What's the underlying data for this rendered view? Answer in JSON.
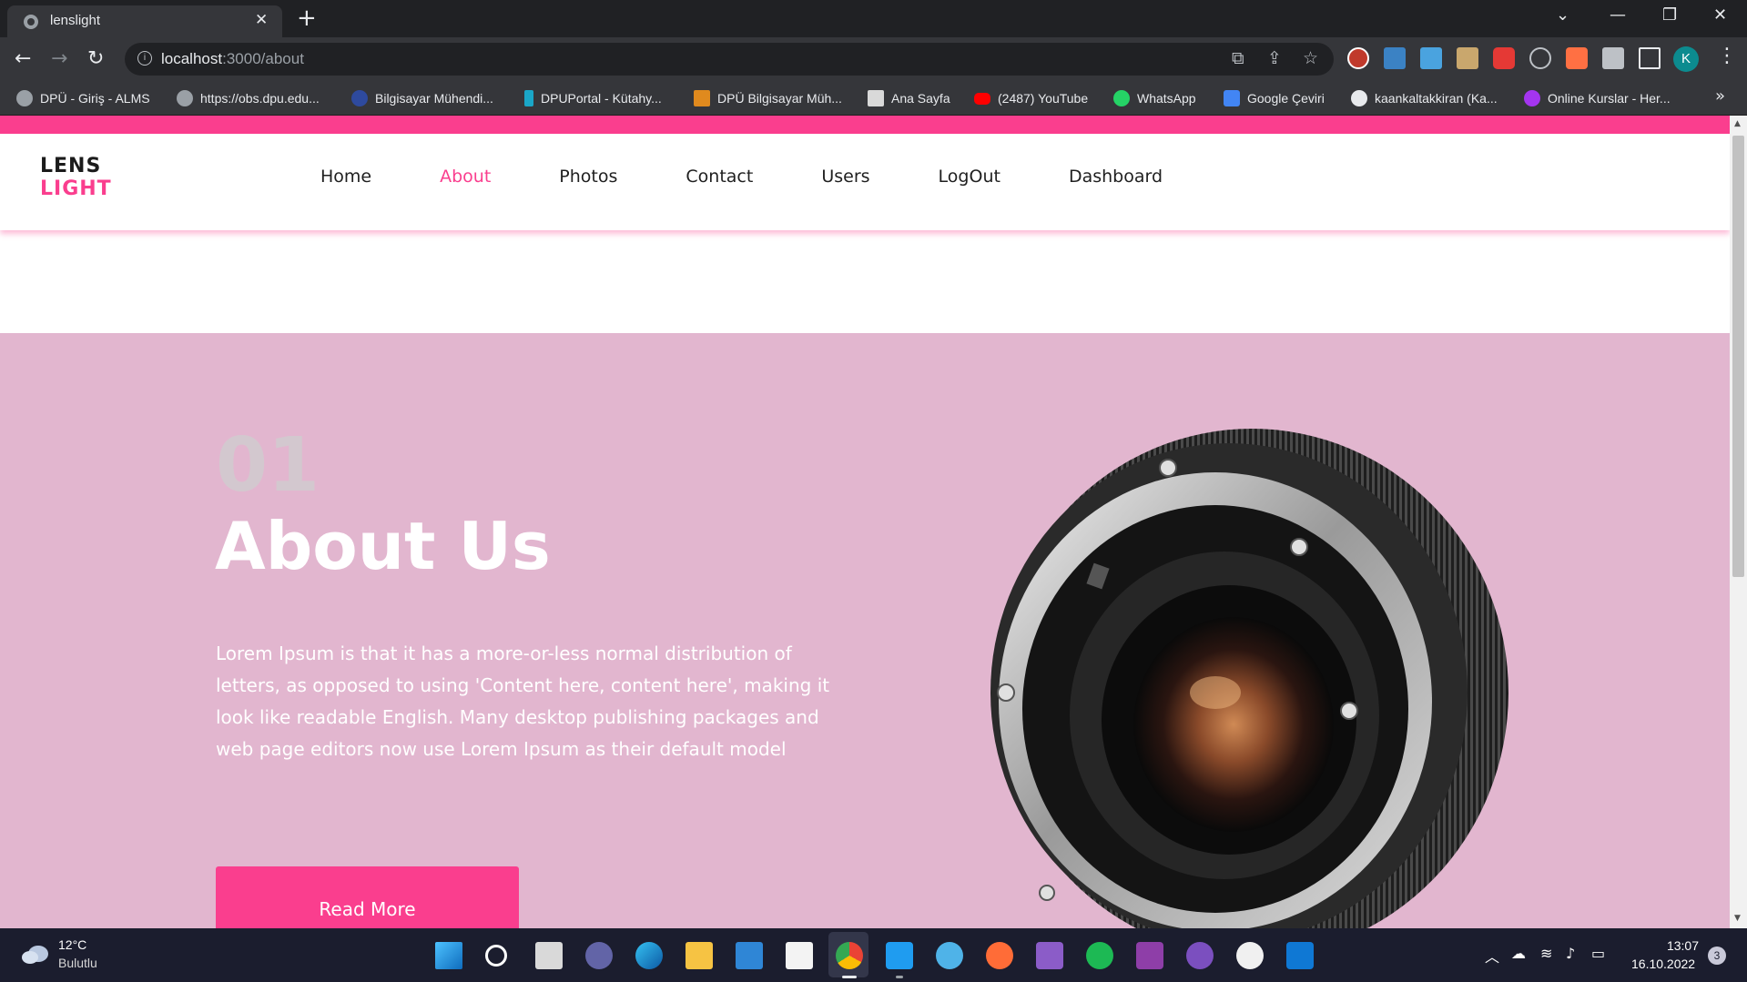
{
  "browser": {
    "tab_title": "lenslight",
    "url_host": "localhost",
    "url_path": ":3000/about",
    "profile_initial": "K",
    "bookmarks": [
      "DPÜ - Giriş - ALMS",
      "https://obs.dpu.edu...",
      "Bilgisayar Mühendi...",
      "DPUPortal - Kütahy...",
      "DPÜ Bilgisayar Müh...",
      "Ana Sayfa",
      "(2487) YouTube",
      "WhatsApp",
      "Google Çeviri",
      "kaankaltakkiran (Ka...",
      "Online Kurslar - Her..."
    ]
  },
  "site": {
    "logo_line1": "LENS",
    "logo_line2": "LIGHT",
    "nav": [
      "Home",
      "About",
      "Photos",
      "Contact",
      "Users",
      "LogOut",
      "Dashboard"
    ],
    "active_nav": "About",
    "accent_color": "#fa3e8e",
    "section_bg": "#e2b6cf"
  },
  "about": {
    "number": "01",
    "title": "About Us",
    "text": "Lorem Ipsum is that it has a more-or-less normal distribution of letters, as opposed to using 'Content here, content here', making it look like readable English. Many desktop publishing packages and web page editors now use Lorem Ipsum as their default model",
    "button": "Read More",
    "image_alt": "camera-lens"
  },
  "taskbar": {
    "temperature": "12°C",
    "weather": "Bulutlu",
    "time": "13:07",
    "date": "16.10.2022",
    "notifications": "3",
    "apps": [
      "windows-start",
      "search",
      "task-view",
      "teams-chat",
      "edge",
      "file-explorer",
      "mail",
      "microsoft-store",
      "chrome",
      "vscode",
      "paint",
      "postman",
      "visual-studio",
      "spotify",
      "arduino",
      "github-desktop",
      "notion",
      "outlook"
    ]
  }
}
